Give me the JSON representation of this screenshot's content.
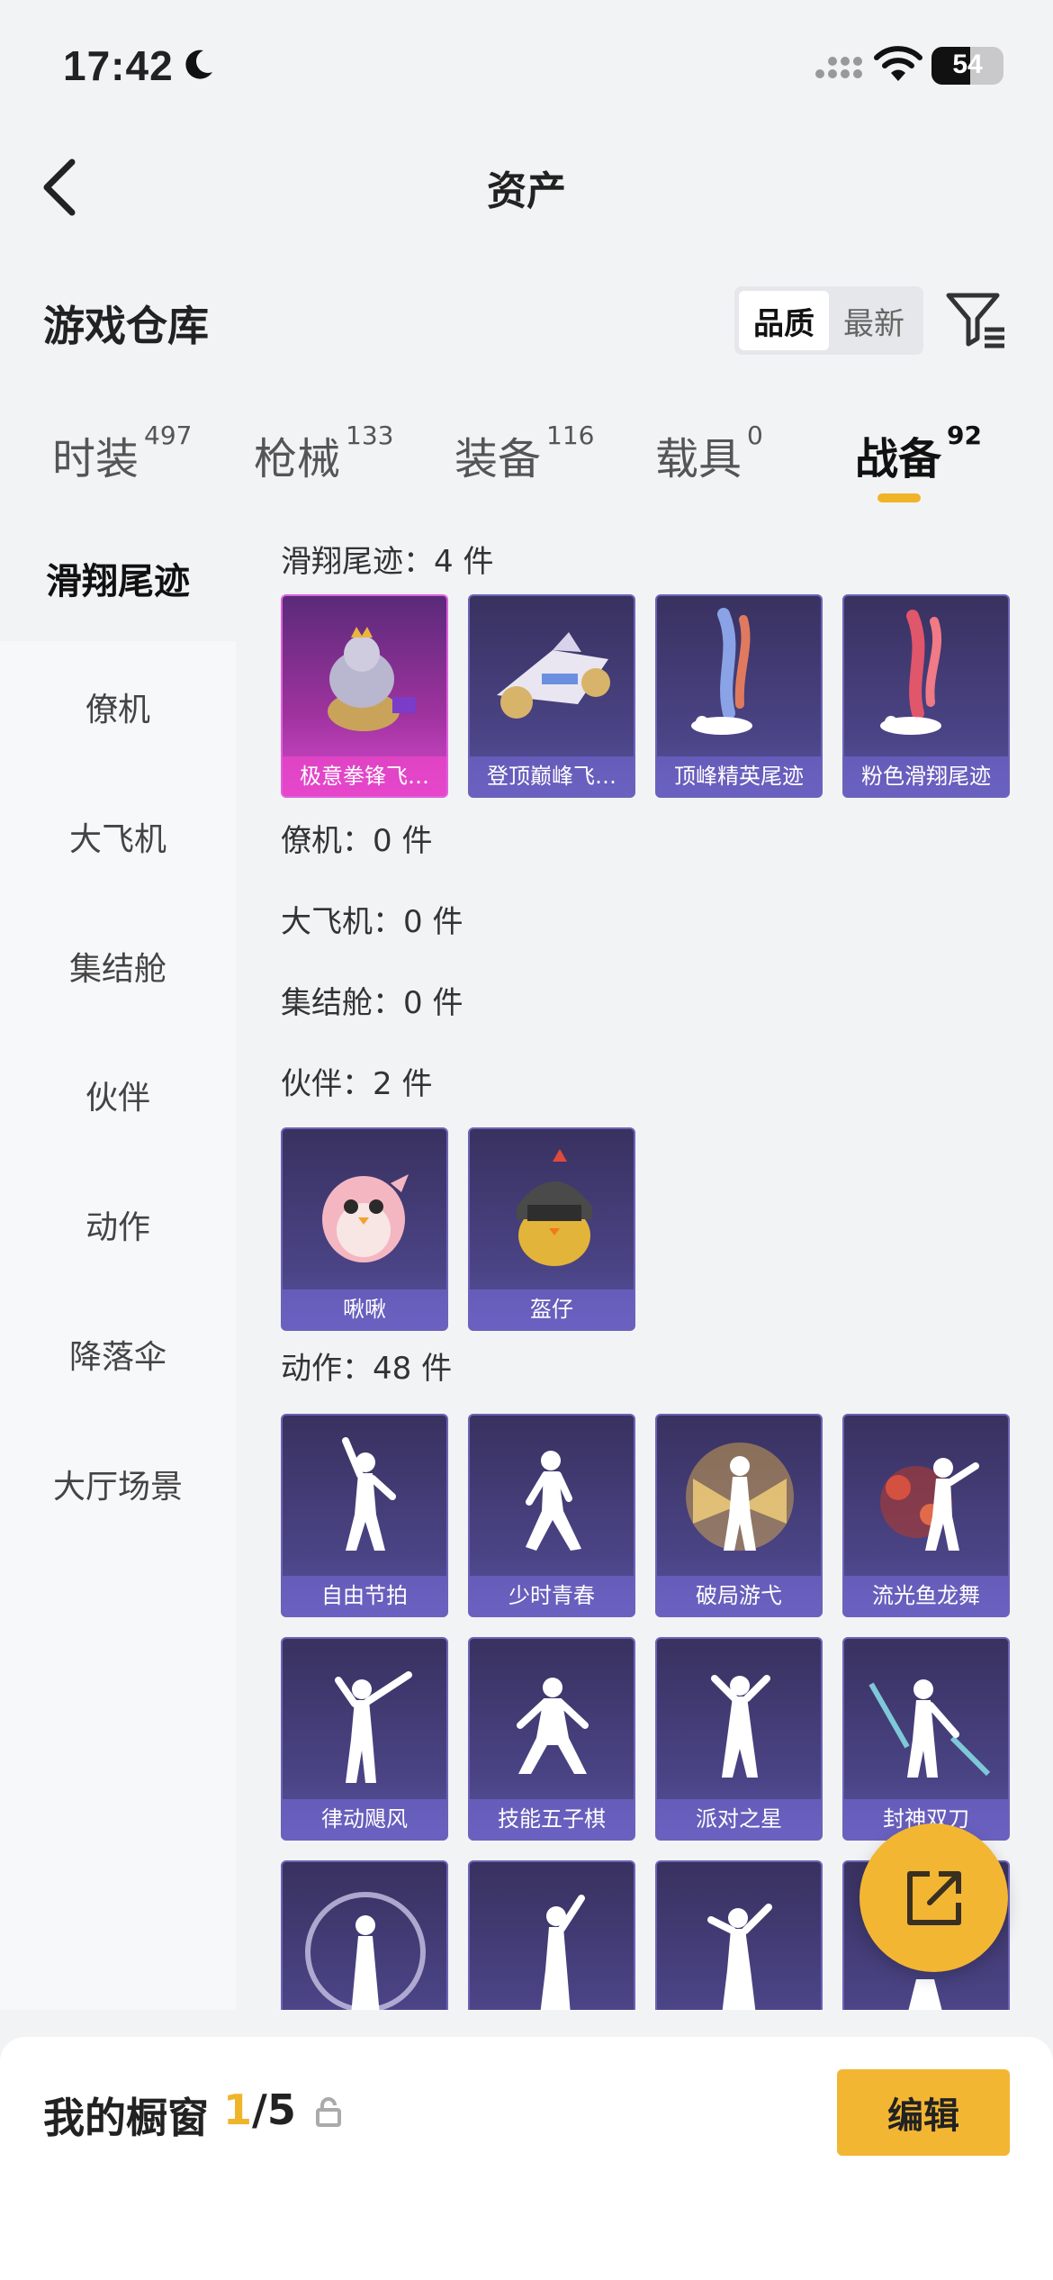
{
  "status_bar": {
    "time": "17:42",
    "battery": "54",
    "battery_level_percent": 54
  },
  "nav": {
    "title": "资产",
    "icons": {
      "back": "chevron-left-icon"
    }
  },
  "warehouse": {
    "title": "游戏仓库",
    "sort_options": [
      {
        "label": "品质",
        "selected": true
      },
      {
        "label": "最新",
        "selected": false
      }
    ],
    "filter_icon": "filter-icon"
  },
  "tabs": [
    {
      "label": "时装",
      "count": "497",
      "selected": false
    },
    {
      "label": "枪械",
      "count": "133",
      "selected": false
    },
    {
      "label": "装备",
      "count": "116",
      "selected": false
    },
    {
      "label": "载具",
      "count": "0",
      "selected": false
    },
    {
      "label": "战备",
      "count": "92",
      "selected": true
    }
  ],
  "sidebar": {
    "items": [
      {
        "label": "滑翔尾迹",
        "selected": true
      },
      {
        "label": "僚机",
        "selected": false
      },
      {
        "label": "大飞机",
        "selected": false
      },
      {
        "label": "集结舱",
        "selected": false
      },
      {
        "label": "伙伴",
        "selected": false
      },
      {
        "label": "动作",
        "selected": false
      },
      {
        "label": "降落伞",
        "selected": false
      },
      {
        "label": "大厅场景",
        "selected": false
      }
    ]
  },
  "sections": {
    "glide": {
      "header": "滑翔尾迹：4 件",
      "items": [
        "极意拳锋飞…",
        "登顶巅峰飞…",
        "顶峰精英尾迹",
        "粉色滑翔尾迹"
      ]
    },
    "wingman": {
      "header": "僚机：0 件"
    },
    "plane": {
      "header": "大飞机：0 件"
    },
    "pod": {
      "header": "集结舱：0 件"
    },
    "partner": {
      "header": "伙伴：2 件",
      "items": [
        "啾啾",
        "盔仔"
      ]
    },
    "emote": {
      "header": "动作：48 件",
      "items": [
        "自由节拍",
        "少时青春",
        "破局游弋",
        "流光鱼龙舞",
        "律动飓风",
        "技能五子棋",
        "派对之星",
        "封神双刀"
      ]
    }
  },
  "fab": {
    "icon": "share-external-icon"
  },
  "showcase": {
    "title": "我的橱窗",
    "current": "1",
    "total": "/5",
    "lock_icon": "lock-icon",
    "edit_label": "编辑"
  },
  "colors": {
    "accent": "#f3b633",
    "card_bg": "#3f3872",
    "legendary_card": "#b63ab8"
  }
}
